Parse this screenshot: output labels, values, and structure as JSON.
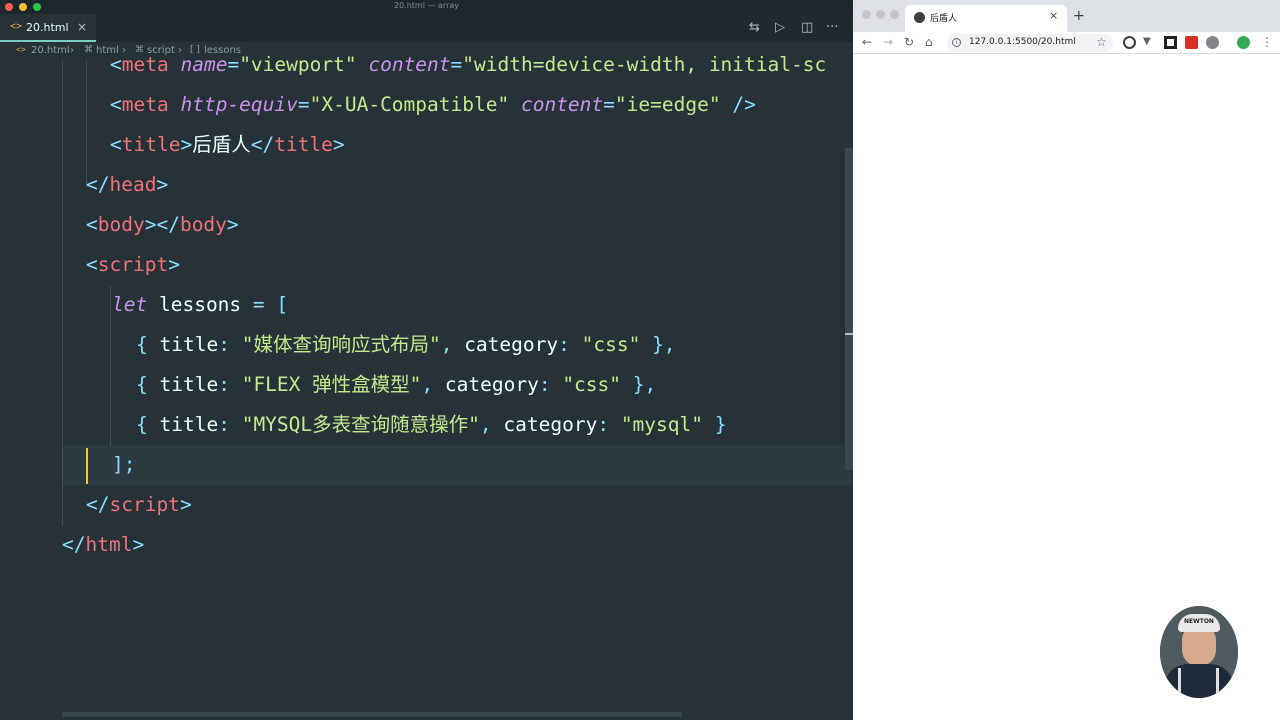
{
  "editor": {
    "window_title": "20.html — array",
    "tab": {
      "label": "20.html",
      "close": "×"
    },
    "breadcrumb": [
      "20.html",
      "html",
      "script",
      "lessons"
    ],
    "code": {
      "l1": {
        "open": "<",
        "tag": "meta",
        "a1": "name",
        "eq": "=",
        "v1": "\"viewport\"",
        "a2": "content",
        "v2": "\"width=device-width, initial-sc"
      },
      "l2": {
        "open": "<",
        "tag": "meta",
        "a1": "http-equiv",
        "eq": "=",
        "v1": "\"X-UA-Compatible\"",
        "a2": "content",
        "v2": "\"ie=edge\"",
        "close": "/>"
      },
      "l3": {
        "open": "<",
        "tag": "title",
        "gt": ">",
        "text": "后盾人",
        "endopen": "</",
        "endtag": "title",
        "endgt": ">"
      },
      "l4": {
        "open": "</",
        "tag": "head",
        "gt": ">"
      },
      "l5": {
        "open": "<",
        "tag": "body",
        "gt": ">",
        "endopen": "</",
        "endtag": "body",
        "endgt": ">"
      },
      "l6": {
        "open": "<",
        "tag": "script",
        "gt": ">"
      },
      "l7": {
        "kw": "let",
        "name": "lessons",
        "eq": "=",
        "br": "["
      },
      "l8": {
        "ob": "{",
        "k1": "title",
        "c": ":",
        "v1": "\"媒体查询响应式布局\"",
        "comma": ",",
        "k2": "category",
        "v2": "\"css\"",
        "cb": "},",
        "end": ""
      },
      "l9": {
        "ob": "{",
        "k1": "title",
        "c": ":",
        "v1": "\"FLEX 弹性盒模型\"",
        "comma": ",",
        "k2": "category",
        "v2": "\"css\"",
        "cb": "},"
      },
      "l10": {
        "ob": "{",
        "k1": "title",
        "c": ":",
        "v1": "\"MYSQL多表查询随意操作\"",
        "comma": ",",
        "k2": "category",
        "v2": "\"mysql\"",
        "cb": "}"
      },
      "l11": {
        "text": "];"
      },
      "l12": {
        "open": "</",
        "tag": "script",
        "gt": ">"
      },
      "l13": {
        "open": "</",
        "tag": "html",
        "gt": ">"
      }
    }
  },
  "browser": {
    "tab_title": "后盾人",
    "tab_close": "×",
    "new_tab": "+",
    "url_host": "127.0.0.1",
    "url_rest": ":5500/20.html",
    "webcam_cap_text": "NEWTON"
  },
  "colors": {
    "editor_bg": "#263238",
    "tag": "#f07178",
    "attr": "#c792ea",
    "string": "#c3e88d",
    "punct": "#89ddff"
  }
}
